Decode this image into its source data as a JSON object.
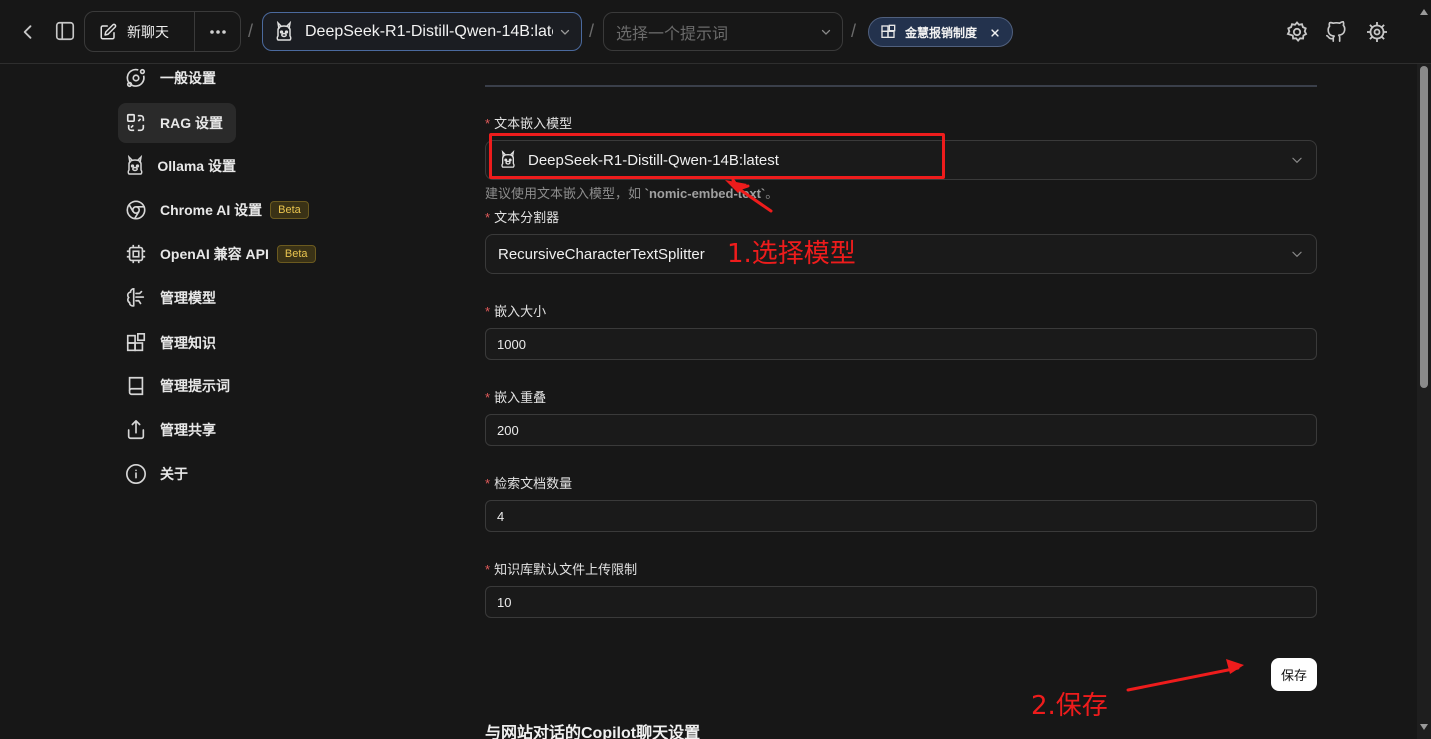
{
  "topbar": {
    "new_chat_label": "新聊天",
    "selected_model": "DeepSeek-R1-Distill-Qwen-14B:latest",
    "prompt_placeholder": "选择一个提示词",
    "knowledge_base": "金慧报销制度",
    "separator": "/"
  },
  "sidebar": {
    "items": [
      {
        "label": "一般设置",
        "icon": "orbit-icon"
      },
      {
        "label": "RAG 设置",
        "icon": "rag-icon"
      },
      {
        "label": "Ollama 设置",
        "icon": "ollama-icon"
      },
      {
        "label": "Chrome AI 设置",
        "icon": "chrome-icon",
        "badge": "Beta"
      },
      {
        "label": "OpenAI 兼容 API",
        "icon": "chip-icon",
        "badge": "Beta"
      },
      {
        "label": "管理模型",
        "icon": "brain-icon"
      },
      {
        "label": "管理知识",
        "icon": "blocks-icon"
      },
      {
        "label": "管理提示词",
        "icon": "book-icon"
      },
      {
        "label": "管理共享",
        "icon": "share-icon"
      },
      {
        "label": "关于",
        "icon": "info-icon"
      }
    ],
    "active_index": 1
  },
  "form": {
    "embedding_model_label": "文本嵌入模型",
    "embedding_model_value": "DeepSeek-R1-Distill-Qwen-14B:latest",
    "embedding_hint_prefix": "建议使用文本嵌入模型，如 ",
    "embedding_hint_code": "`nomic-embed-text`",
    "embedding_hint_suffix": "。",
    "splitter_label": "文本分割器",
    "splitter_value": "RecursiveCharacterTextSplitter",
    "chunk_size_label": "嵌入大小",
    "chunk_size_value": "1000",
    "chunk_overlap_label": "嵌入重叠",
    "chunk_overlap_value": "200",
    "doc_count_label": "检索文档数量",
    "doc_count_value": "4",
    "upload_limit_label": "知识库默认文件上传限制",
    "upload_limit_value": "10",
    "required_mark": "*",
    "save_label": "保存",
    "next_section_title": "与网站对话的Copilot聊天设置"
  },
  "annotations": {
    "step1": "1.选择模型",
    "step2": "2.保存",
    "color": "#ee1c1c"
  }
}
